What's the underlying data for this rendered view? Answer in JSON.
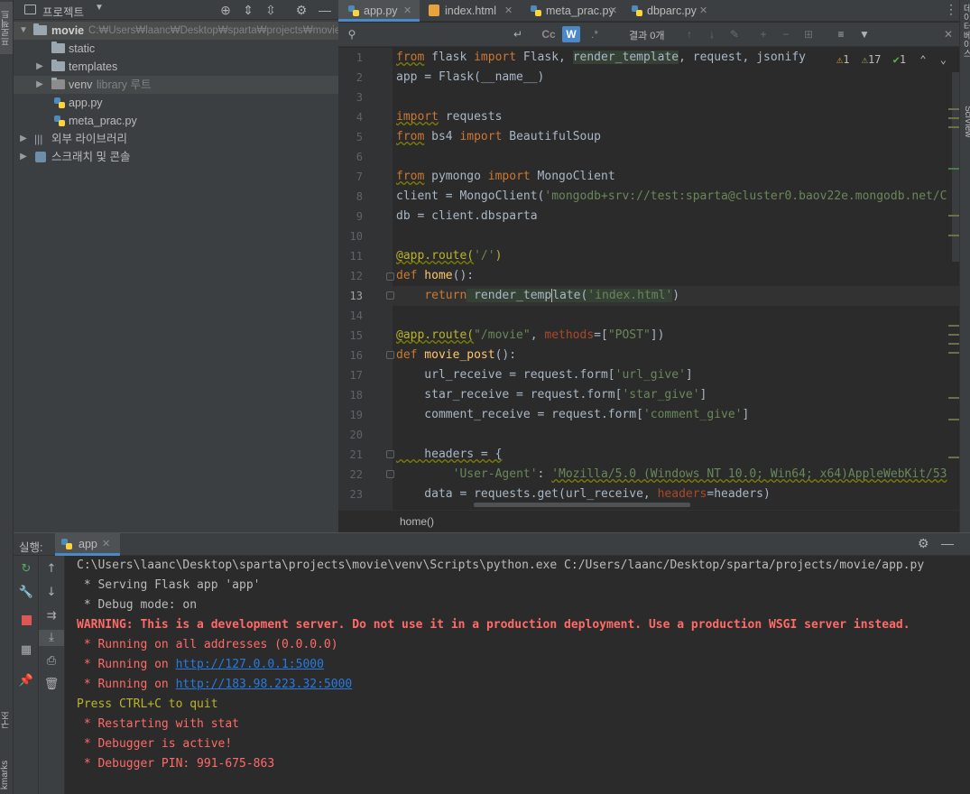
{
  "left_strip": {
    "project_tab": "프로젝트",
    "structure_tab": "구조",
    "bookmarks_tab": "kmarks"
  },
  "right_strip": {
    "database_tab": "데이터베이스",
    "sciview_tab": "SciView"
  },
  "project": {
    "title": "프로젝트",
    "root_name": "movie",
    "root_path": "C:₩Users₩laanc₩Desktop₩sparta₩projects₩movie",
    "items": [
      {
        "name": "static"
      },
      {
        "name": "templates"
      },
      {
        "name": "venv",
        "suffix": "library 루트"
      },
      {
        "name": "app.py"
      },
      {
        "name": "meta_prac.py"
      }
    ],
    "external_libs": "외부 라이브러리",
    "scratches": "스크래치 및 콘솔"
  },
  "tabs": [
    {
      "label": "app.py",
      "active": true
    },
    {
      "label": "index.html",
      "active": false
    },
    {
      "label": "meta_prac.py",
      "active": false
    },
    {
      "label": "dbparc.py",
      "active": false
    }
  ],
  "find_bar": {
    "match_case": "Cc",
    "words": "W",
    "regex": ".*",
    "results": "결과 0개"
  },
  "inspections": {
    "warnings": "1",
    "weak_warnings": "17",
    "typos": "1"
  },
  "editor": {
    "current_line": 13,
    "line_numbers": [
      "1",
      "2",
      "3",
      "4",
      "5",
      "6",
      "7",
      "8",
      "9",
      "10",
      "11",
      "12",
      "13",
      "14",
      "15",
      "16",
      "17",
      "18",
      "19",
      "20",
      "21",
      "22",
      "23"
    ]
  },
  "breadcrumb": "home()",
  "run": {
    "label": "실행:",
    "tab": "app",
    "console": [
      {
        "text": "C:\\Users\\laanc\\Desktop\\sparta\\projects\\movie\\venv\\Scripts\\python.exe C:/Users/laanc/Desktop/sparta/projects/movie/app.py",
        "style": "norm"
      },
      {
        "text": " * Serving Flask app 'app'",
        "style": "norm"
      },
      {
        "text": " * Debug mode: on",
        "style": "norm"
      },
      {
        "text": "WARNING: This is a development server. Do not use it in a production deployment. Use a production WSGI server instead.",
        "style": "warn"
      },
      {
        "text": " * Running on all addresses (0.0.0.0)",
        "style": "err"
      },
      {
        "text": " * Running on ",
        "style": "err",
        "link": "http://127.0.0.1:5000"
      },
      {
        "text": " * Running on ",
        "style": "err",
        "link": "http://183.98.223.32:5000"
      },
      {
        "text": "Press CTRL+C to quit",
        "style": "yel"
      },
      {
        "text": " * Restarting with stat",
        "style": "err"
      },
      {
        "text": " * Debugger is active!",
        "style": "err"
      },
      {
        "text": " * Debugger PIN: 991-675-863",
        "style": "err"
      }
    ]
  },
  "code": {
    "l1": {
      "kw1": "from",
      "mod": " flask ",
      "kw2": "import",
      "names1": " Flask, ",
      "rt": "render_template",
      "names2": ", request, jsonify"
    },
    "l2": {
      "text": "app = Flask(__name__)"
    },
    "l4": {
      "kw": "import",
      "rest": " requests"
    },
    "l5": {
      "kw1": "from",
      "mod": " bs4 ",
      "kw2": "import",
      "rest": " BeautifulSoup"
    },
    "l7": {
      "kw1": "from",
      "mod": " pymongo ",
      "kw2": "import",
      "rest": " MongoClient"
    },
    "l8": {
      "pre": "client = MongoClient(",
      "str": "'mongodb+srv://test:sparta@cluster0.baov22e.mongodb.net/C"
    },
    "l9": {
      "text": "db = client.dbsparta"
    },
    "l11": {
      "dec": "@app.route(",
      "str": "'/'",
      "close": ")"
    },
    "l12": {
      "kw": "def",
      "fn": " home",
      "rest": "():"
    },
    "l13": {
      "indent": "    ",
      "kw": "return",
      "call1": " render_temp",
      "call2": "late(",
      "str": "'index.html'",
      "close": ")"
    },
    "l15": {
      "dec": "@app.route(",
      "str": "\"/movie\"",
      "comma": ", ",
      "param": "methods",
      "eq": "=[",
      "str2": "\"POST\"",
      "close": "])"
    },
    "l16": {
      "kw": "def",
      "fn": " movie_post",
      "rest": "():"
    },
    "l17": {
      "pre": "    url_receive = request.form[",
      "str": "'url_give'",
      "close": "]"
    },
    "l18": {
      "pre": "    star_receive = request.form[",
      "str": "'star_give'",
      "close": "]"
    },
    "l19": {
      "pre": "    comment_receive = request.form[",
      "str": "'comment_give'",
      "close": "]"
    },
    "l21": {
      "pre": "    headers = {"
    },
    "l22": {
      "pre": "        ",
      "key": "'User-Agent'",
      "colon": ": ",
      "str": "'Mozilla/5.0 (Windows NT 10.0; Win64; x64)AppleWebKit/53"
    },
    "l23": {
      "pre": "    data = requests.get(url_receive, ",
      "param": "headers",
      "rest": "=headers)"
    }
  },
  "colors": {
    "accent": "#4a88c7",
    "background": "#2b2b2b",
    "panel": "#3c3f41"
  }
}
